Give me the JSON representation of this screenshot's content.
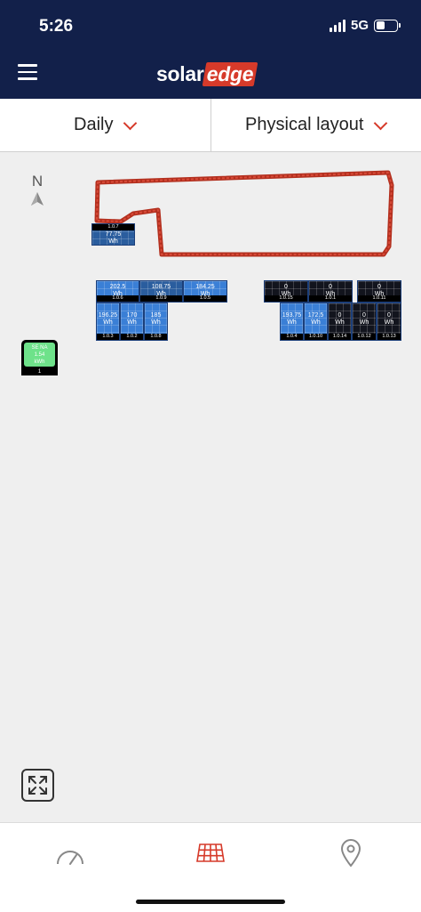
{
  "status_bar": {
    "time": "5:26",
    "network": "5G"
  },
  "header": {
    "logo_part1": "solar",
    "logo_part2": "edge"
  },
  "selectors": {
    "period": "Daily",
    "view": "Physical layout"
  },
  "compass": {
    "north_label": "N"
  },
  "colors": {
    "brand_navy": "#12204a",
    "accent_red": "#d63a2a",
    "panel_blue": "#3a7fd6",
    "inverter_green": "#6ee28a"
  },
  "top_panel": {
    "label": "1.0.7",
    "value": "77.75",
    "unit": "Wh"
  },
  "group_left_top": [
    {
      "value": "202.5",
      "unit": "Wh",
      "label": "1.0.6"
    },
    {
      "value": "108.75",
      "unit": "Wh",
      "label": "1.0.9"
    },
    {
      "value": "184.25",
      "unit": "Wh",
      "label": "1.0.5"
    }
  ],
  "group_left_bottom": [
    {
      "value": "196.25",
      "unit": "Wh",
      "label": "1.0.3"
    },
    {
      "value": "170",
      "unit": "Wh",
      "label": "1.0.2"
    },
    {
      "value": "185",
      "unit": "Wh",
      "label": "1.0.8"
    }
  ],
  "group_right_top": [
    {
      "value": "0",
      "unit": "Wh",
      "label": "1.0.15"
    },
    {
      "value": "0",
      "unit": "Wh",
      "label": "1.0.1"
    },
    {
      "value": "0",
      "unit": "Wh",
      "label": "1.0.11"
    }
  ],
  "group_right_bottom": [
    {
      "value": "193.75",
      "unit": "Wh",
      "label": "1.0.4"
    },
    {
      "value": "172.5",
      "unit": "Wh",
      "label": "1.0.10"
    },
    {
      "value": "0",
      "unit": "Wh",
      "label": "1.0.14"
    },
    {
      "value": "0",
      "unit": "Wh",
      "label": "1.0.12"
    },
    {
      "value": "0",
      "unit": "Wh",
      "label": "1.0.13"
    }
  ],
  "inverter": {
    "name": "SE NA",
    "value": "1.54",
    "unit": "kWh",
    "index": "1"
  },
  "bottom_nav": [
    "dashboard-icon",
    "layout-icon",
    "location-icon"
  ]
}
